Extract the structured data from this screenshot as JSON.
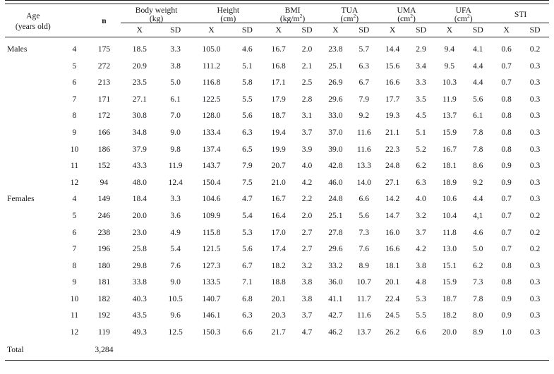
{
  "table": {
    "caption_present": false,
    "header": {
      "age_label_line1": "Age",
      "age_label_line2": "(years old)",
      "n_label": "n",
      "groups": [
        {
          "name": "Body weight",
          "unit": "(kg)",
          "unit_sup": ""
        },
        {
          "name": "Height",
          "unit": "(cm)",
          "unit_sup": ""
        },
        {
          "name": "BMI",
          "unit": "(kg/m",
          "unit_sup": "2",
          "unit_close": ")"
        },
        {
          "name": "TUA",
          "unit": "(cm",
          "unit_sup": "2",
          "unit_close": ")"
        },
        {
          "name": "UMA",
          "unit": "(cm",
          "unit_sup": "2",
          "unit_close": ")"
        },
        {
          "name": "UFA",
          "unit": "(cm",
          "unit_sup": "2",
          "unit_close": ")"
        },
        {
          "name": "STI",
          "unit": "",
          "unit_sup": ""
        }
      ],
      "sub_x": "X",
      "sub_sd": "SD"
    },
    "rows": [
      {
        "sex": "Males",
        "age": "4",
        "n": "175",
        "bw_x": "18.5",
        "bw_sd": "3.3",
        "ht_x": "105.0",
        "ht_sd": "4.6",
        "bmi_x": "16.7",
        "bmi_sd": "2.0",
        "tua_x": "23.8",
        "tua_sd": "5.7",
        "uma_x": "14.4",
        "uma_sd": "2.9",
        "ufa_x": "9.4",
        "ufa_sd": "4.1",
        "sti_x": "0.6",
        "sti_sd": "0.2"
      },
      {
        "sex": "",
        "age": "5",
        "n": "272",
        "bw_x": "20.9",
        "bw_sd": "3.8",
        "ht_x": "111.2",
        "ht_sd": "5.1",
        "bmi_x": "16.8",
        "bmi_sd": "2.1",
        "tua_x": "25.1",
        "tua_sd": "6.3",
        "uma_x": "15.6",
        "uma_sd": "3.4",
        "ufa_x": "9.5",
        "ufa_sd": "4.4",
        "sti_x": "0.7",
        "sti_sd": "0.3"
      },
      {
        "sex": "",
        "age": "6",
        "n": "213",
        "bw_x": "23.5",
        "bw_sd": "5.0",
        "ht_x": "116.8",
        "ht_sd": "5.8",
        "bmi_x": "17.1",
        "bmi_sd": "2.5",
        "tua_x": "26.9",
        "tua_sd": "6.7",
        "uma_x": "16.6",
        "uma_sd": "3.3",
        "ufa_x": "10.3",
        "ufa_sd": "4.4",
        "sti_x": "0.7",
        "sti_sd": "0.3"
      },
      {
        "sex": "",
        "age": "7",
        "n": "171",
        "bw_x": "27.1",
        "bw_sd": "6.1",
        "ht_x": "122.5",
        "ht_sd": "5.5",
        "bmi_x": "17.9",
        "bmi_sd": "2.8",
        "tua_x": "29.6",
        "tua_sd": "7.9",
        "uma_x": "17.7",
        "uma_sd": "3.5",
        "ufa_x": "11.9",
        "ufa_sd": "5.6",
        "sti_x": "0.8",
        "sti_sd": "0.3"
      },
      {
        "sex": "",
        "age": "8",
        "n": "172",
        "bw_x": "30.8",
        "bw_sd": "7.0",
        "ht_x": "128.0",
        "ht_sd": "5.6",
        "bmi_x": "18.7",
        "bmi_sd": "3.1",
        "tua_x": "33.0",
        "tua_sd": "9.2",
        "uma_x": "19.3",
        "uma_sd": "4.5",
        "ufa_x": "13.7",
        "ufa_sd": "6.1",
        "sti_x": "0.8",
        "sti_sd": "0.3"
      },
      {
        "sex": "",
        "age": "9",
        "n": "166",
        "bw_x": "34.8",
        "bw_sd": "9.0",
        "ht_x": "133.4",
        "ht_sd": "6.3",
        "bmi_x": "19.4",
        "bmi_sd": "3.7",
        "tua_x": "37.0",
        "tua_sd": "11.6",
        "uma_x": "21.1",
        "uma_sd": "5.1",
        "ufa_x": "15.9",
        "ufa_sd": "7.8",
        "sti_x": "0.8",
        "sti_sd": "0.3"
      },
      {
        "sex": "",
        "age": "10",
        "n": "186",
        "bw_x": "37.9",
        "bw_sd": "9.8",
        "ht_x": "137.4",
        "ht_sd": "6.5",
        "bmi_x": "19.9",
        "bmi_sd": "3.9",
        "tua_x": "39.0",
        "tua_sd": "11.6",
        "uma_x": "22.3",
        "uma_sd": "5.2",
        "ufa_x": "16.7",
        "ufa_sd": "7.8",
        "sti_x": "0.8",
        "sti_sd": "0.3"
      },
      {
        "sex": "",
        "age": "11",
        "n": "152",
        "bw_x": "43.3",
        "bw_sd": "11.9",
        "ht_x": "143.7",
        "ht_sd": "7.9",
        "bmi_x": "20.7",
        "bmi_sd": "4.0",
        "tua_x": "42.8",
        "tua_sd": "13.3",
        "uma_x": "24.8",
        "uma_sd": "6.2",
        "ufa_x": "18.1",
        "ufa_sd": "8.6",
        "sti_x": "0.9",
        "sti_sd": "0.3"
      },
      {
        "sex": "",
        "age": "12",
        "n": "94",
        "bw_x": "48.0",
        "bw_sd": "12.4",
        "ht_x": "150.4",
        "ht_sd": "7.5",
        "bmi_x": "21.0",
        "bmi_sd": "4.2",
        "tua_x": "46.0",
        "tua_sd": "14.0",
        "uma_x": "27.1",
        "uma_sd": "6.3",
        "ufa_x": "18.9",
        "ufa_sd": "9.2",
        "sti_x": "0.9",
        "sti_sd": "0.3"
      },
      {
        "sex": "Females",
        "age": "4",
        "n": "149",
        "bw_x": "18.4",
        "bw_sd": "3.3",
        "ht_x": "104.6",
        "ht_sd": "4.7",
        "bmi_x": "16.7",
        "bmi_sd": "2.2",
        "tua_x": "24.8",
        "tua_sd": "6.6",
        "uma_x": "14.2",
        "uma_sd": "4.0",
        "ufa_x": "10.6",
        "ufa_sd": "4.4",
        "sti_x": "0.7",
        "sti_sd": "0.3"
      },
      {
        "sex": "",
        "age": "5",
        "n": "246",
        "bw_x": "20.0",
        "bw_sd": "3.6",
        "ht_x": "109.9",
        "ht_sd": "5.4",
        "bmi_x": "16.4",
        "bmi_sd": "2.0",
        "tua_x": "25.1",
        "tua_sd": "5.6",
        "uma_x": "14.7",
        "uma_sd": "3.2",
        "ufa_x": "10.4",
        "ufa_sd": "4,1",
        "sti_x": "0.7",
        "sti_sd": "0.2"
      },
      {
        "sex": "",
        "age": "6",
        "n": "238",
        "bw_x": "23.0",
        "bw_sd": "4.9",
        "ht_x": "115.8",
        "ht_sd": "5.3",
        "bmi_x": "17.0",
        "bmi_sd": "2.7",
        "tua_x": "27.8",
        "tua_sd": "7.3",
        "uma_x": "16.0",
        "uma_sd": "3.7",
        "ufa_x": "11.8",
        "ufa_sd": "4.6",
        "sti_x": "0.7",
        "sti_sd": "0.2"
      },
      {
        "sex": "",
        "age": "7",
        "n": "196",
        "bw_x": "25.8",
        "bw_sd": "5.4",
        "ht_x": "121.5",
        "ht_sd": "5.6",
        "bmi_x": "17.4",
        "bmi_sd": "2.7",
        "tua_x": "29.6",
        "tua_sd": "7.6",
        "uma_x": "16.6",
        "uma_sd": "4.2",
        "ufa_x": "13.0",
        "ufa_sd": "5.0",
        "sti_x": "0.7",
        "sti_sd": "0.2"
      },
      {
        "sex": "",
        "age": "8",
        "n": "180",
        "bw_x": "29.8",
        "bw_sd": "7.6",
        "ht_x": "127.3",
        "ht_sd": "6.7",
        "bmi_x": "18.2",
        "bmi_sd": "3.2",
        "tua_x": "33.2",
        "tua_sd": "8.9",
        "uma_x": "18.1",
        "uma_sd": "3.8",
        "ufa_x": "15.1",
        "ufa_sd": "6.2",
        "sti_x": "0.8",
        "sti_sd": "0.3"
      },
      {
        "sex": "",
        "age": "9",
        "n": "181",
        "bw_x": "33.8",
        "bw_sd": "9.0",
        "ht_x": "133.5",
        "ht_sd": "7.1",
        "bmi_x": "18.8",
        "bmi_sd": "3.8",
        "tua_x": "36.0",
        "tua_sd": "10.7",
        "uma_x": "20.1",
        "uma_sd": "4.8",
        "ufa_x": "15.9",
        "ufa_sd": "7.3",
        "sti_x": "0.8",
        "sti_sd": "0.3"
      },
      {
        "sex": "",
        "age": "10",
        "n": "182",
        "bw_x": "40.3",
        "bw_sd": "10.5",
        "ht_x": "140.7",
        "ht_sd": "6.8",
        "bmi_x": "20.1",
        "bmi_sd": "3.8",
        "tua_x": "41.1",
        "tua_sd": "11.7",
        "uma_x": "22.4",
        "uma_sd": "5.3",
        "ufa_x": "18.7",
        "ufa_sd": "7.8",
        "sti_x": "0.9",
        "sti_sd": "0.3"
      },
      {
        "sex": "",
        "age": "11",
        "n": "192",
        "bw_x": "43.5",
        "bw_sd": "9.6",
        "ht_x": "146.1",
        "ht_sd": "6.3",
        "bmi_x": "20.3",
        "bmi_sd": "3.7",
        "tua_x": "42.7",
        "tua_sd": "11.6",
        "uma_x": "24.5",
        "uma_sd": "5.5",
        "ufa_x": "18.2",
        "ufa_sd": "8.0",
        "sti_x": "0.9",
        "sti_sd": "0.3"
      },
      {
        "sex": "",
        "age": "12",
        "n": "119",
        "bw_x": "49.3",
        "bw_sd": "12.5",
        "ht_x": "150.3",
        "ht_sd": "6.6",
        "bmi_x": "21.7",
        "bmi_sd": "4.7",
        "tua_x": "46.2",
        "tua_sd": "13.7",
        "uma_x": "26.2",
        "uma_sd": "6.6",
        "ufa_x": "20.0",
        "ufa_sd": "8.9",
        "sti_x": "1.0",
        "sti_sd": "0.3"
      }
    ],
    "total": {
      "label": "Total",
      "age": "",
      "n": "3,284"
    }
  }
}
